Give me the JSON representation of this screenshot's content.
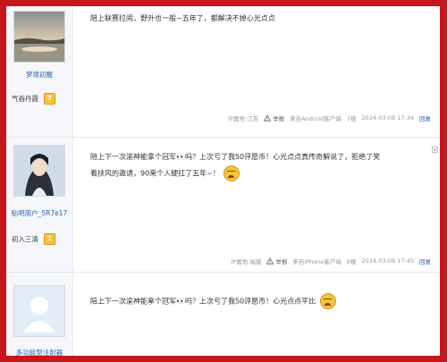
{
  "posts": [
    {
      "username": "梦境初醒",
      "level_name": "气吞丹霞",
      "level_num": "7",
      "content_lines": [
        "陪上联赛拉闹，野外也一般~五年了，都解决不掉心光点点"
      ],
      "ip": "IP属地:江苏",
      "report": "举报",
      "client": "来自Android客户端",
      "floor": "7楼",
      "time": "2024-03-08 17:34",
      "reply": "回复"
    },
    {
      "username": "贴吧用户_5R7e17",
      "level_name": "初入三清",
      "level_num": "1",
      "content_lines": [
        "陪上下一次渝神能拿个冠军👀吗？上次亏了我50评愿币！心光点点真传奇解说了，拒绝了笑",
        "看扶风的邀请，90来个人硬扛了五年~！"
      ],
      "ip": "IP属地:福建",
      "report": "举报",
      "client": "来自iPhone客户端",
      "floor": "8楼",
      "time": "2024-03-08 17:45",
      "reply": "回复"
    },
    {
      "username": "多功能型注射器",
      "content_lines": [
        "陪上下一次渝神能拿个冠军👀吗？上次亏了我50评愿币！心光点点平比"
      ]
    }
  ],
  "icons": {
    "report": "warning-icon",
    "emoji": "angry-face-icon",
    "dropdown": "chevron-down-icon"
  },
  "colors": {
    "frame": "#c8161d",
    "link": "#2d64b3"
  }
}
